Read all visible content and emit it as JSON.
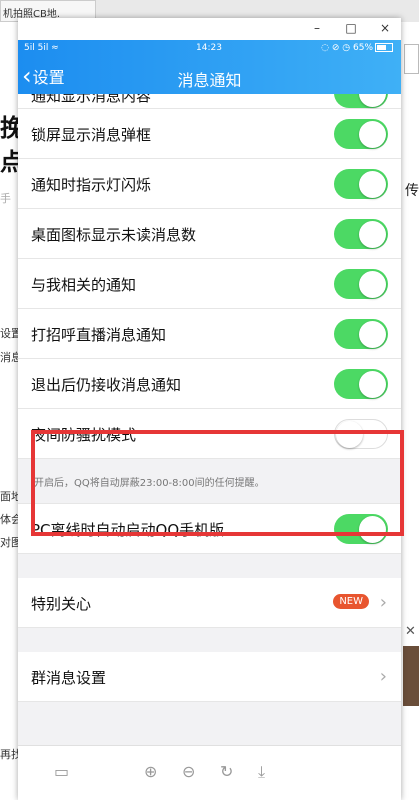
{
  "background": {
    "tab_text": "机拍照CB地.",
    "left_texts": [
      "挽_",
      "点",
      "手",
      "设置",
      "消息",
      "面地",
      "体会",
      "对图",
      "再找"
    ],
    "right_text": "传输"
  },
  "window": {
    "min": "–",
    "max": "□",
    "close": "×"
  },
  "statusbar": {
    "signal": "5il 5il ≈",
    "time": "14:23",
    "right": "◌ ⊘ ◷ 65%"
  },
  "navbar": {
    "back_label": "设置",
    "title": "消息通知"
  },
  "rows": [
    {
      "label": "通知显示消息内容",
      "on": true
    },
    {
      "label": "锁屏显示消息弹框",
      "on": true
    },
    {
      "label": "通知时指示灯闪烁",
      "on": true
    },
    {
      "label": "桌面图标显示未读消息数",
      "on": true
    },
    {
      "label": "与我相关的通知",
      "on": true
    },
    {
      "label": "打招呼直播消息通知",
      "on": true
    },
    {
      "label": "退出后仍接收消息通知",
      "on": true
    },
    {
      "label": "夜间防骚扰模式",
      "on": false
    }
  ],
  "night_hint": "开启后，QQ将自动屏蔽23:00-8:00间的任何提醒。",
  "pc_row": {
    "label": "PC离线时自动启动QQ手机版",
    "on": true
  },
  "special": {
    "label": "特别关心",
    "badge": "NEW"
  },
  "group": {
    "label": "群消息设置"
  },
  "toolbar": {
    "icons": [
      "tablet-icon",
      "zoom-in-icon",
      "zoom-out-icon",
      "rotate-icon",
      "download-icon"
    ],
    "glyphs": [
      "▭",
      "⊕",
      "⊖",
      "↻",
      "⤓"
    ]
  }
}
